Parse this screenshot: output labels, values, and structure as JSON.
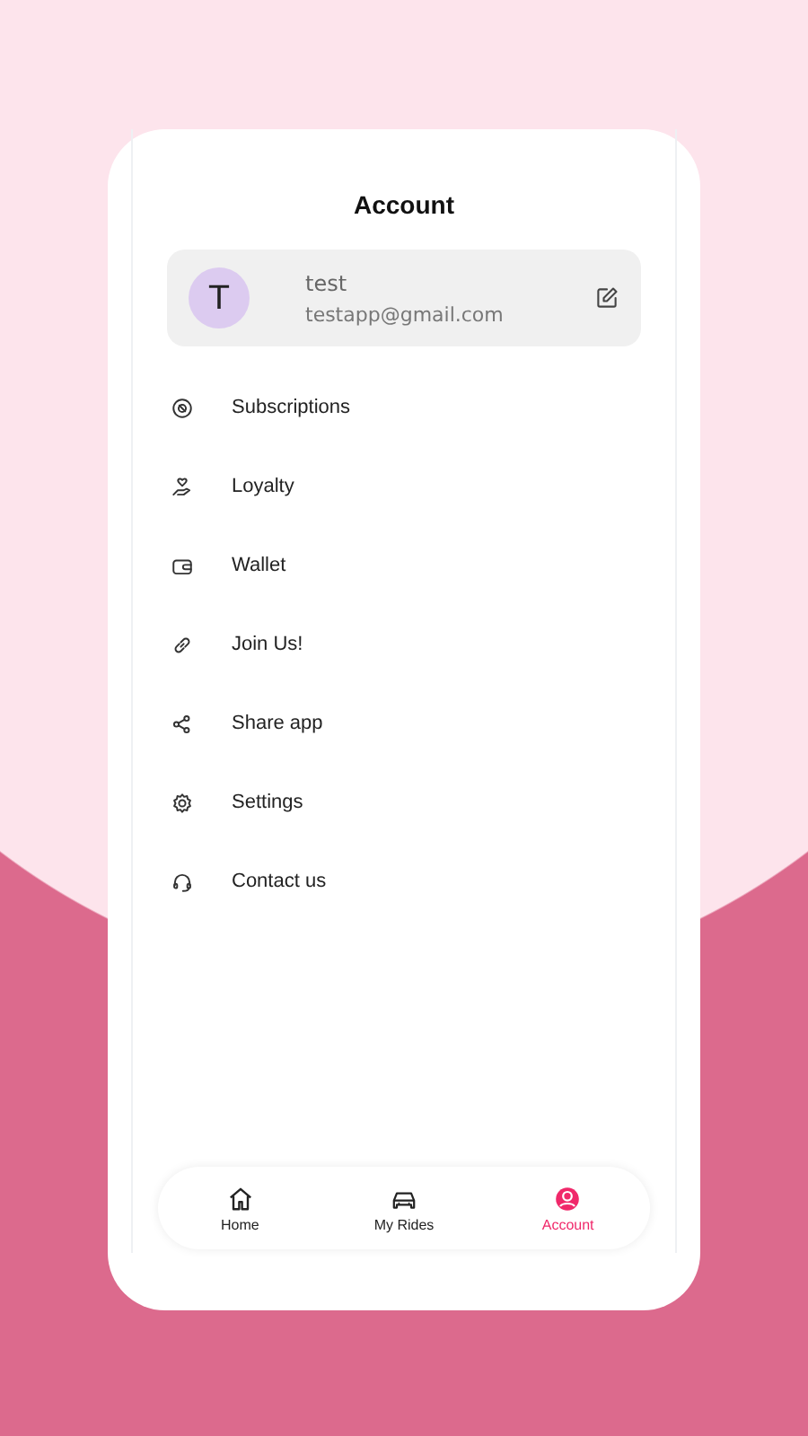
{
  "screen": {
    "title": "Account"
  },
  "profile": {
    "initial": "T",
    "name": "test",
    "email": "testapp@gmail.com"
  },
  "menu": [
    {
      "kind": "subscriptions",
      "label": "Subscriptions"
    },
    {
      "kind": "loyalty",
      "label": "Loyalty"
    },
    {
      "kind": "wallet",
      "label": "Wallet"
    },
    {
      "kind": "link",
      "label": "Join Us!"
    },
    {
      "kind": "share",
      "label": "Share app"
    },
    {
      "kind": "settings",
      "label": "Settings"
    },
    {
      "kind": "contact",
      "label": "Contact us"
    }
  ],
  "nav": [
    {
      "kind": "home",
      "label": "Home",
      "selected": false
    },
    {
      "kind": "car",
      "label": "My Rides",
      "selected": false
    },
    {
      "kind": "account",
      "label": "Account",
      "selected": true
    }
  ]
}
